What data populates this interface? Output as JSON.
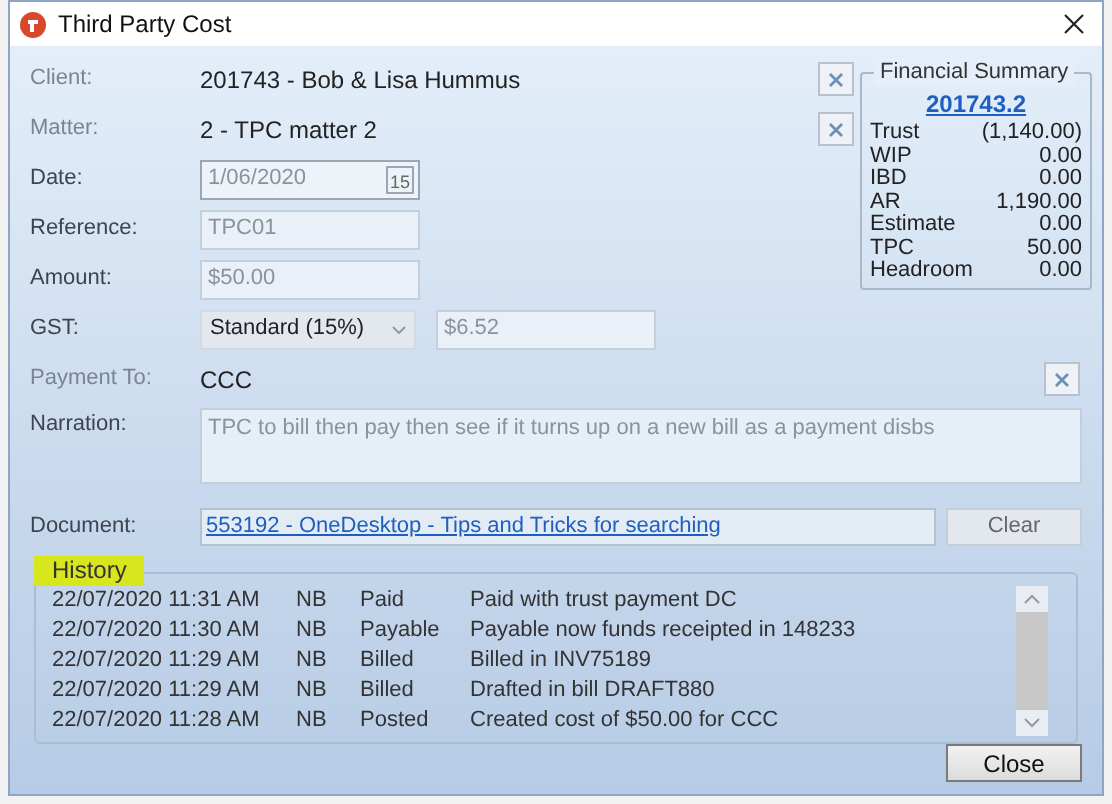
{
  "window": {
    "title": "Third Party Cost"
  },
  "fields": [
    {
      "kind": "text",
      "label": "Client:",
      "label_disabled": true,
      "value": "201743 - Bob & Lisa Hummus",
      "clear": true
    },
    {
      "kind": "text",
      "label": "Matter:",
      "label_disabled": true,
      "value": "2 - TPC matter 2",
      "clear": true
    },
    {
      "kind": "date",
      "label": "Date:",
      "label_disabled": false,
      "value": "1/06/2020",
      "disabled": true,
      "icon_text": "15"
    },
    {
      "kind": "input",
      "label": "Reference:",
      "label_disabled": false,
      "value": "TPC01",
      "disabled": true
    },
    {
      "kind": "input",
      "label": "Amount:",
      "label_disabled": false,
      "value": "$50.00",
      "disabled": true
    },
    {
      "kind": "gst",
      "label": "GST:",
      "label_disabled": false,
      "value": "Standard (15%)",
      "amount": "$6.52",
      "disabled": true
    },
    {
      "kind": "text",
      "label": "Payment To:",
      "label_disabled": true,
      "value": "CCC",
      "clear": true
    },
    {
      "kind": "textarea",
      "label": "Narration:",
      "label_disabled": false,
      "value": "TPC to bill then pay then see if it turns up on a new bill as a payment disbs",
      "disabled": true
    },
    {
      "kind": "document",
      "label": "Document:",
      "label_disabled": false,
      "value": "553192 - OneDesktop - Tips and Tricks for searching",
      "button": "Clear"
    }
  ],
  "financial_summary": {
    "title": "Financial Summary",
    "matter": "201743.2",
    "rows": [
      {
        "label": "Trust",
        "value": "(1,140.00)"
      },
      {
        "label": "WIP",
        "value": "0.00"
      },
      {
        "label": "IBD",
        "value": "0.00"
      },
      {
        "label": "AR",
        "value": "1,190.00"
      },
      {
        "label": "Estimate",
        "value": "0.00"
      },
      {
        "label": "TPC",
        "value": "50.00"
      },
      {
        "label": "Headroom",
        "value": "0.00"
      }
    ]
  },
  "history": {
    "title": "History",
    "highlighted": true,
    "rows": [
      {
        "time": "22/07/2020 11:31 AM",
        "user": "NB",
        "status": "Paid",
        "note": "Paid with trust payment DC"
      },
      {
        "time": "22/07/2020 11:30 AM",
        "user": "NB",
        "status": "Payable",
        "note": "Payable now funds receipted in 148233"
      },
      {
        "time": "22/07/2020 11:29 AM",
        "user": "NB",
        "status": "Billed",
        "note": "Billed in INV75189"
      },
      {
        "time": "22/07/2020 11:29 AM",
        "user": "NB",
        "status": "Billed",
        "note": "Drafted in bill DRAFT880"
      },
      {
        "time": "22/07/2020 11:28 AM",
        "user": "NB",
        "status": "Posted",
        "note": "Created cost of $50.00 for CCC"
      }
    ]
  },
  "buttons": [
    "Close"
  ]
}
